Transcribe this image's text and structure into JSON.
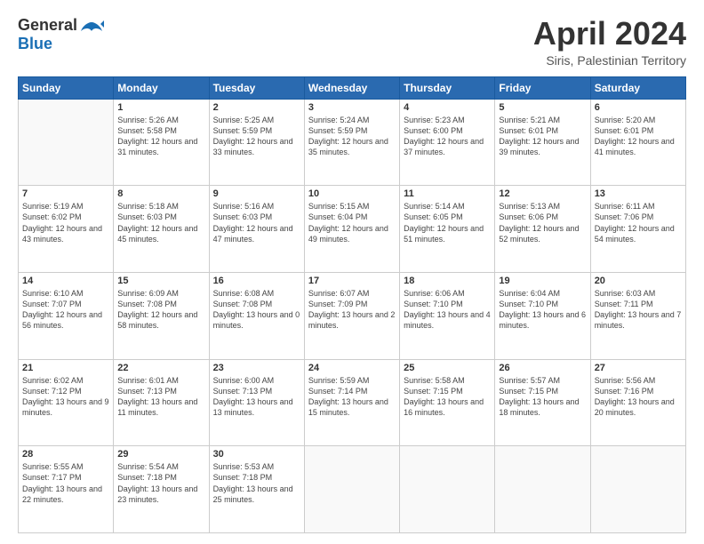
{
  "header": {
    "logo_line1": "General",
    "logo_line2": "Blue",
    "month_title": "April 2024",
    "subtitle": "Siris, Palestinian Territory"
  },
  "days_of_week": [
    "Sunday",
    "Monday",
    "Tuesday",
    "Wednesday",
    "Thursday",
    "Friday",
    "Saturday"
  ],
  "weeks": [
    [
      {
        "day": "",
        "info": ""
      },
      {
        "day": "1",
        "info": "Sunrise: 5:26 AM\nSunset: 5:58 PM\nDaylight: 12 hours\nand 31 minutes."
      },
      {
        "day": "2",
        "info": "Sunrise: 5:25 AM\nSunset: 5:59 PM\nDaylight: 12 hours\nand 33 minutes."
      },
      {
        "day": "3",
        "info": "Sunrise: 5:24 AM\nSunset: 5:59 PM\nDaylight: 12 hours\nand 35 minutes."
      },
      {
        "day": "4",
        "info": "Sunrise: 5:23 AM\nSunset: 6:00 PM\nDaylight: 12 hours\nand 37 minutes."
      },
      {
        "day": "5",
        "info": "Sunrise: 5:21 AM\nSunset: 6:01 PM\nDaylight: 12 hours\nand 39 minutes."
      },
      {
        "day": "6",
        "info": "Sunrise: 5:20 AM\nSunset: 6:01 PM\nDaylight: 12 hours\nand 41 minutes."
      }
    ],
    [
      {
        "day": "7",
        "info": "Sunrise: 5:19 AM\nSunset: 6:02 PM\nDaylight: 12 hours\nand 43 minutes."
      },
      {
        "day": "8",
        "info": "Sunrise: 5:18 AM\nSunset: 6:03 PM\nDaylight: 12 hours\nand 45 minutes."
      },
      {
        "day": "9",
        "info": "Sunrise: 5:16 AM\nSunset: 6:03 PM\nDaylight: 12 hours\nand 47 minutes."
      },
      {
        "day": "10",
        "info": "Sunrise: 5:15 AM\nSunset: 6:04 PM\nDaylight: 12 hours\nand 49 minutes."
      },
      {
        "day": "11",
        "info": "Sunrise: 5:14 AM\nSunset: 6:05 PM\nDaylight: 12 hours\nand 51 minutes."
      },
      {
        "day": "12",
        "info": "Sunrise: 5:13 AM\nSunset: 6:06 PM\nDaylight: 12 hours\nand 52 minutes."
      },
      {
        "day": "13",
        "info": "Sunrise: 6:11 AM\nSunset: 7:06 PM\nDaylight: 12 hours\nand 54 minutes."
      }
    ],
    [
      {
        "day": "14",
        "info": "Sunrise: 6:10 AM\nSunset: 7:07 PM\nDaylight: 12 hours\nand 56 minutes."
      },
      {
        "day": "15",
        "info": "Sunrise: 6:09 AM\nSunset: 7:08 PM\nDaylight: 12 hours\nand 58 minutes."
      },
      {
        "day": "16",
        "info": "Sunrise: 6:08 AM\nSunset: 7:08 PM\nDaylight: 13 hours\nand 0 minutes."
      },
      {
        "day": "17",
        "info": "Sunrise: 6:07 AM\nSunset: 7:09 PM\nDaylight: 13 hours\nand 2 minutes."
      },
      {
        "day": "18",
        "info": "Sunrise: 6:06 AM\nSunset: 7:10 PM\nDaylight: 13 hours\nand 4 minutes."
      },
      {
        "day": "19",
        "info": "Sunrise: 6:04 AM\nSunset: 7:10 PM\nDaylight: 13 hours\nand 6 minutes."
      },
      {
        "day": "20",
        "info": "Sunrise: 6:03 AM\nSunset: 7:11 PM\nDaylight: 13 hours\nand 7 minutes."
      }
    ],
    [
      {
        "day": "21",
        "info": "Sunrise: 6:02 AM\nSunset: 7:12 PM\nDaylight: 13 hours\nand 9 minutes."
      },
      {
        "day": "22",
        "info": "Sunrise: 6:01 AM\nSunset: 7:13 PM\nDaylight: 13 hours\nand 11 minutes."
      },
      {
        "day": "23",
        "info": "Sunrise: 6:00 AM\nSunset: 7:13 PM\nDaylight: 13 hours\nand 13 minutes."
      },
      {
        "day": "24",
        "info": "Sunrise: 5:59 AM\nSunset: 7:14 PM\nDaylight: 13 hours\nand 15 minutes."
      },
      {
        "day": "25",
        "info": "Sunrise: 5:58 AM\nSunset: 7:15 PM\nDaylight: 13 hours\nand 16 minutes."
      },
      {
        "day": "26",
        "info": "Sunrise: 5:57 AM\nSunset: 7:15 PM\nDaylight: 13 hours\nand 18 minutes."
      },
      {
        "day": "27",
        "info": "Sunrise: 5:56 AM\nSunset: 7:16 PM\nDaylight: 13 hours\nand 20 minutes."
      }
    ],
    [
      {
        "day": "28",
        "info": "Sunrise: 5:55 AM\nSunset: 7:17 PM\nDaylight: 13 hours\nand 22 minutes."
      },
      {
        "day": "29",
        "info": "Sunrise: 5:54 AM\nSunset: 7:18 PM\nDaylight: 13 hours\nand 23 minutes."
      },
      {
        "day": "30",
        "info": "Sunrise: 5:53 AM\nSunset: 7:18 PM\nDaylight: 13 hours\nand 25 minutes."
      },
      {
        "day": "",
        "info": ""
      },
      {
        "day": "",
        "info": ""
      },
      {
        "day": "",
        "info": ""
      },
      {
        "day": "",
        "info": ""
      }
    ]
  ]
}
